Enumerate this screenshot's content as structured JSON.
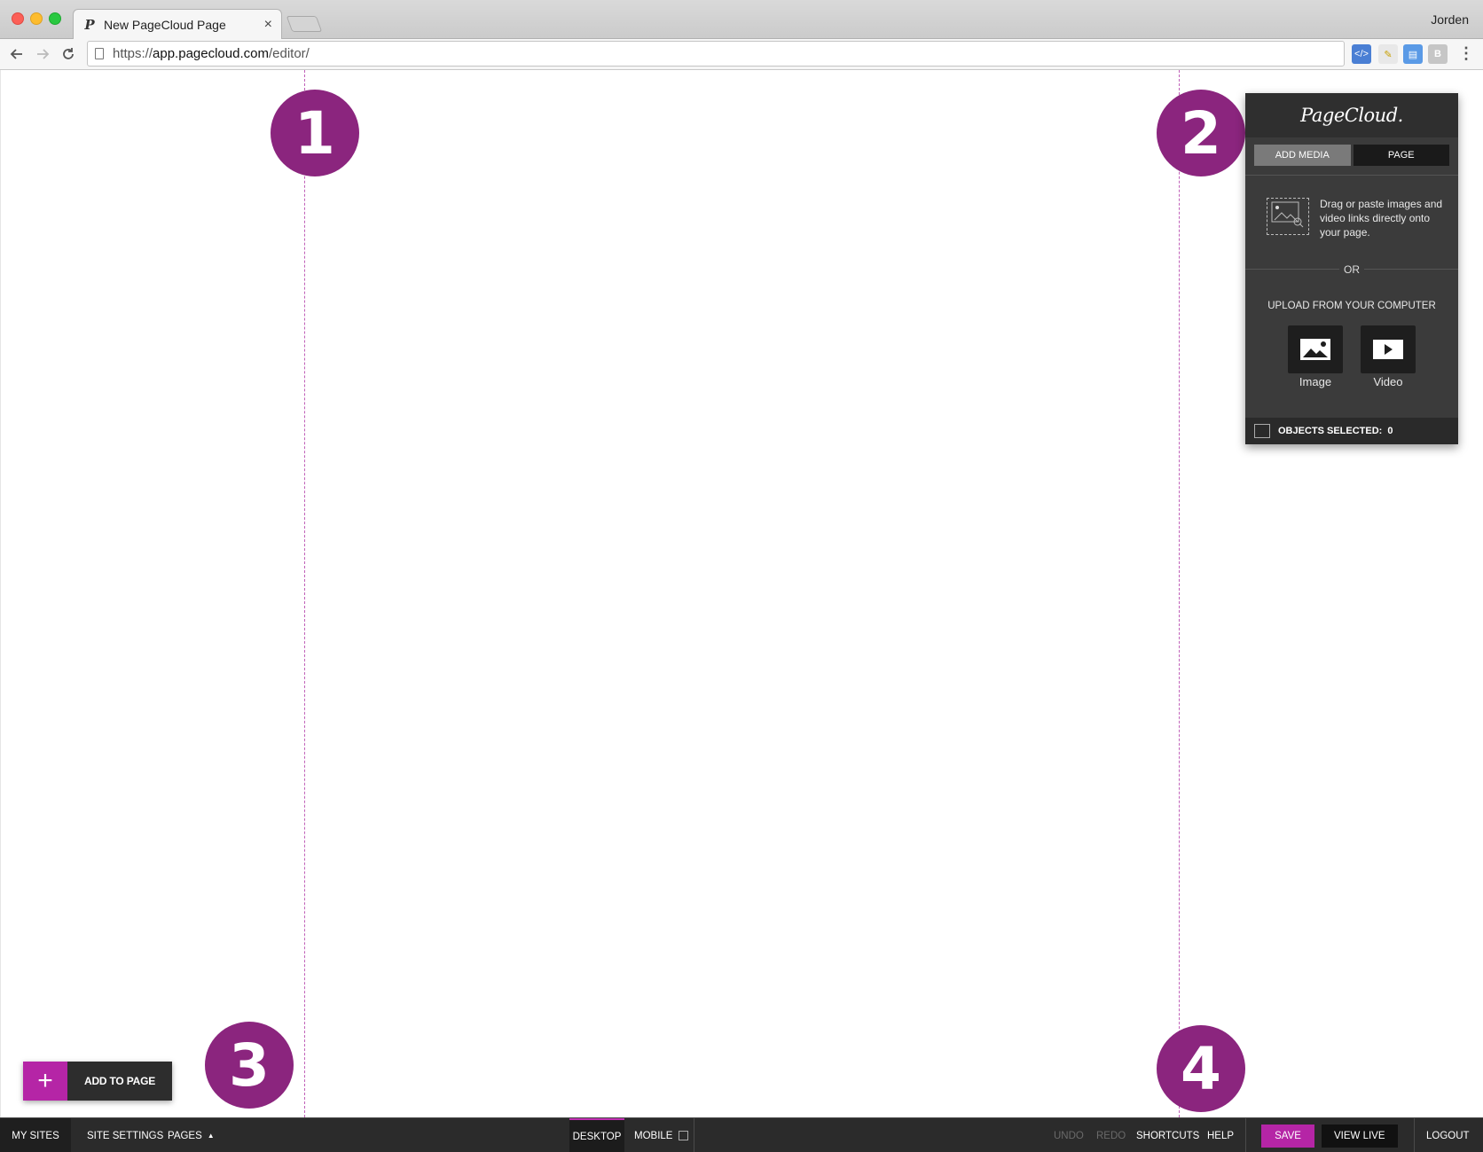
{
  "browser": {
    "tab_title": "New PageCloud Page",
    "tab_close": "×",
    "profile_name": "Jorden",
    "url_scheme": "https://",
    "url_host": "app.pagecloud.com",
    "url_path": "/editor/"
  },
  "callouts": [
    "1",
    "2",
    "3",
    "4"
  ],
  "panel": {
    "logo": "PageCloud.",
    "tabs": [
      {
        "label": "ADD MEDIA",
        "active": true
      },
      {
        "label": "PAGE",
        "active": false
      }
    ],
    "drop_text": "Drag or paste images and video links directly onto your page.",
    "or_label": "OR",
    "upload_label": "UPLOAD FROM YOUR COMPUTER",
    "image_label": "Image",
    "video_label": "Video",
    "objects_label": "OBJECTS SELECTED:",
    "objects_count": "0"
  },
  "add_to_page": {
    "plus": "+",
    "label": "ADD TO PAGE"
  },
  "bottombar": {
    "my_sites": "MY SITES",
    "site_settings": "SITE SETTINGS",
    "pages": "PAGES",
    "pages_caret": "▲",
    "desktop": "DESKTOP",
    "mobile": "MOBILE",
    "undo": "UNDO",
    "redo": "REDO",
    "shortcuts": "SHORTCUTS",
    "help": "HELP",
    "save": "SAVE",
    "view_live": "VIEW LIVE",
    "logout": "LOGOUT"
  },
  "colors": {
    "accent": "#b525a6",
    "callout": "#8b257e",
    "panel_bg": "#3b3b3b",
    "bar_bg": "#2b2b2b"
  }
}
